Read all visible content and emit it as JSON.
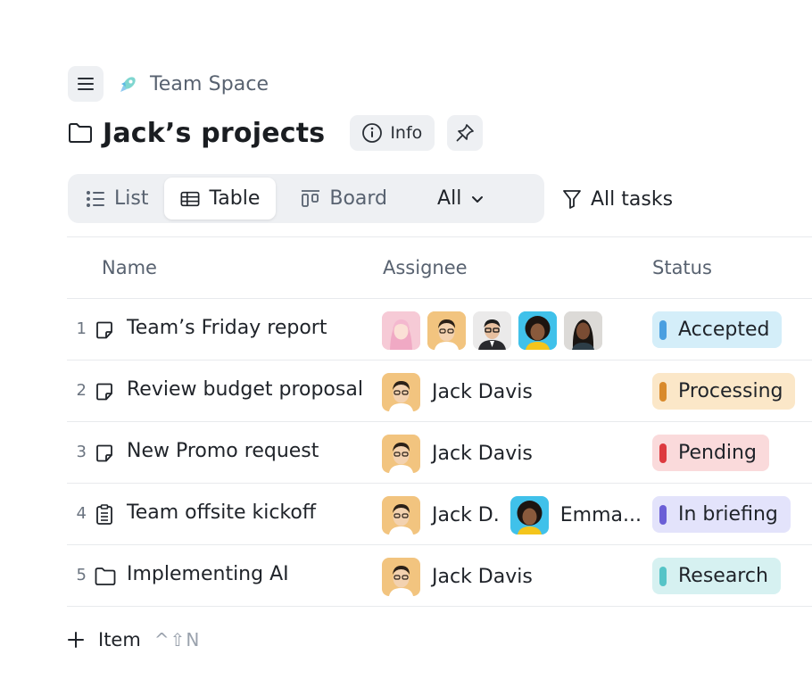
{
  "breadcrumb": {
    "space_name": "Team Space"
  },
  "header": {
    "title": "Jack’s projects",
    "info_label": "Info"
  },
  "views": {
    "list_label": "List",
    "table_label": "Table",
    "board_label": "Board",
    "all_label": "All",
    "active": "Table"
  },
  "filter": {
    "label": "All tasks"
  },
  "table": {
    "columns": {
      "name": "Name",
      "assignee": "Assignee",
      "status": "Status"
    },
    "rows": [
      {
        "num": "1",
        "icon": "note-icon",
        "name": "Team’s Friday report",
        "assignees": [],
        "status": "Accepted",
        "status_bg": "#d4eef9",
        "status_dot": "#4a9fe0"
      },
      {
        "num": "2",
        "icon": "note-icon",
        "name": "Review budget proposal",
        "assignees": [
          "Jack Davis"
        ],
        "status": "Processing",
        "status_bg": "#fbe7c8",
        "status_dot": "#d98a2b"
      },
      {
        "num": "3",
        "icon": "note-icon",
        "name": "New Promo request",
        "assignees": [
          "Jack Davis"
        ],
        "status": "Pending",
        "status_bg": "#fadadb",
        "status_dot": "#dd3a3f"
      },
      {
        "num": "4",
        "icon": "document-icon",
        "name": "Team offsite kickoff",
        "assignees": [
          "Jack D.",
          "Emma..."
        ],
        "status": "In briefing",
        "status_bg": "#e3e3fb",
        "status_dot": "#6b5fd6"
      },
      {
        "num": "5",
        "icon": "folder-icon",
        "name": "Implementing AI",
        "assignees": [
          "Jack Davis"
        ],
        "status": "Research",
        "status_bg": "#d6f1f1",
        "status_dot": "#56c4c7"
      }
    ]
  },
  "add_item": {
    "label": "Item",
    "shortcut": "^⇧N"
  }
}
